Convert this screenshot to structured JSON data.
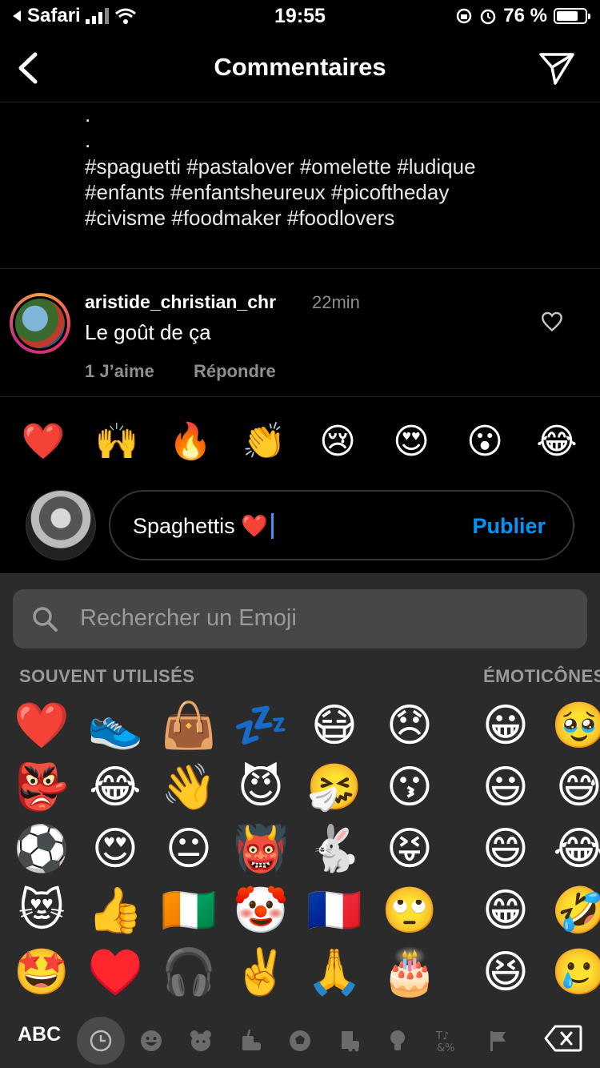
{
  "status_bar": {
    "back_app": "Safari",
    "time": "19:55",
    "battery": "76 %",
    "battery_level": 0.76
  },
  "header": {
    "title": "Commentaires"
  },
  "caption": {
    "dots": [
      ".",
      "."
    ],
    "lines": [
      "#spaguetti #pastalover #omelette #ludique",
      "#enfants #enfantsheureux #picoftheday",
      "#civisme #foodmaker #foodlovers"
    ]
  },
  "comment": {
    "username": "aristide_christian_chr",
    "time": "22min",
    "text": "Le goût de ça",
    "likes": "1 J’aime",
    "reply": "Répondre"
  },
  "quick_emojis": [
    "❤️",
    "🙌",
    "🔥",
    "👏",
    "😢",
    "😍",
    "😮",
    "😂"
  ],
  "input": {
    "value": "Spaghettis ❤️",
    "publish": "Publier"
  },
  "keyboard": {
    "search_placeholder": "Rechercher un Emoji",
    "section_frequent": "SOUVENT UTILISÉS",
    "section_emoticons": "ÉMOTICÔNES",
    "frequent_rows": [
      [
        "❤️",
        "👟",
        "👜",
        "💤",
        "😷",
        "😞"
      ],
      [
        "👺",
        "😂",
        "👋",
        "😈",
        "🤧",
        "😗"
      ],
      [
        "⚽",
        "😍",
        "😐",
        "👹",
        "🐇",
        "😝"
      ],
      [
        "😻",
        "👍",
        "🇨🇮",
        "🤡",
        "🇫🇷",
        "🙄"
      ],
      [
        "🤩",
        "♥️",
        "🎧",
        "✌️",
        "🙏",
        "🎂"
      ]
    ],
    "emoticon_rows": [
      [
        "😀",
        "🥹"
      ],
      [
        "😃",
        "😅"
      ],
      [
        "😄",
        "😂"
      ],
      [
        "😁",
        "🤣"
      ],
      [
        "😆",
        "🥲"
      ]
    ],
    "abc_label": "ABC",
    "categories": [
      "recent-icon",
      "smiley-icon",
      "animal-icon",
      "food-icon",
      "sport-icon",
      "travel-icon",
      "objects-icon",
      "symbols-icon",
      "flag-icon"
    ]
  }
}
